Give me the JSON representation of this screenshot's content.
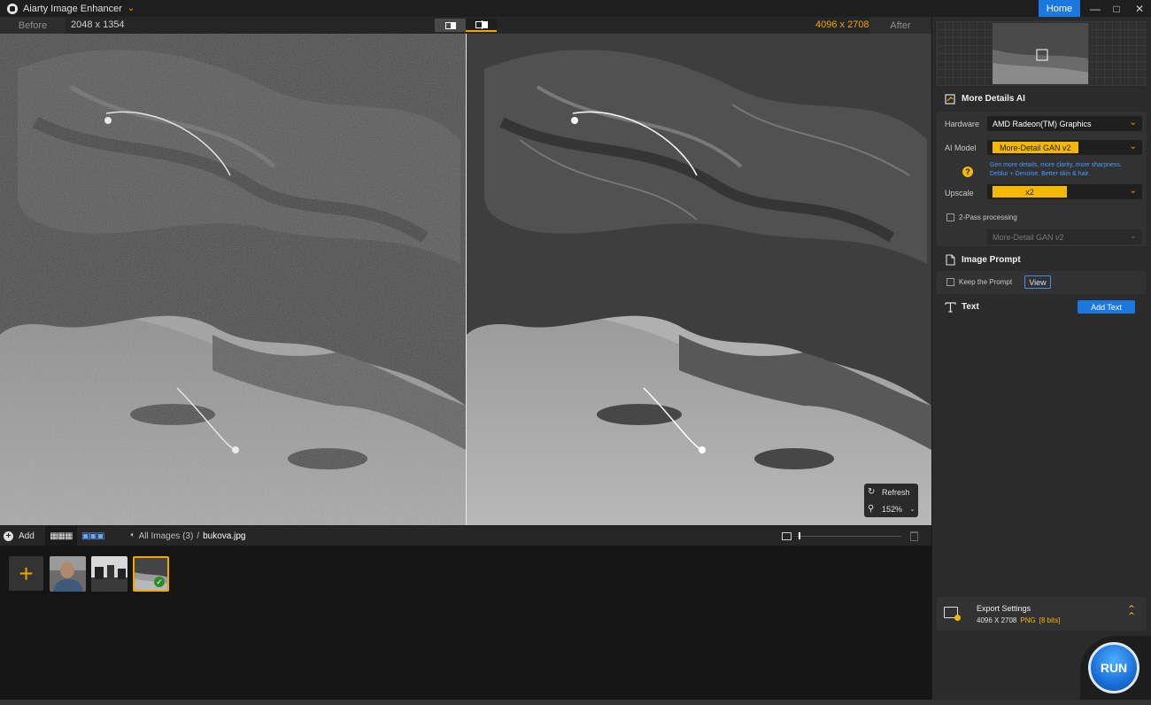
{
  "app": {
    "title": "Aiarty Image Enhancer",
    "home_label": "Home"
  },
  "compare": {
    "before_label": "Before",
    "before_dims": "2048 x 1354",
    "after_label": "After",
    "after_dims": "4096 x 2708"
  },
  "viewer": {
    "refresh_label": "Refresh",
    "zoom_value": "152%"
  },
  "strip": {
    "add_label": "Add",
    "crumb_all": "All Images (3)",
    "crumb_sep": "/",
    "crumb_file": "bukova.jpg",
    "thumb_slider_fraction": 0.02
  },
  "panel": {
    "section_title": "More Details AI",
    "hardware_label": "Hardware",
    "hardware_value": "AMD Radeon(TM) Graphics",
    "ai_model_label": "AI Model",
    "ai_model_value": "More-Detail GAN v2",
    "ai_model_desc_1": "Gen more details, more clarity, more sharpness.",
    "ai_model_desc_2": "Deblur + Denoise. Better skin & hair.",
    "upscale_label": "Upscale",
    "upscale_value": "x2",
    "twopass_label": "2-Pass processing",
    "twopass_model": "More-Detail GAN v2",
    "prompt_title": "Image Prompt",
    "keep_prompt_label": "Keep the Prompt",
    "view_label": "View",
    "text_title": "Text",
    "add_text_label": "Add Text",
    "export_title": "Export Settings",
    "export_dims": "4096 X 2708",
    "export_format": "PNG",
    "export_bits": "[8 bits]",
    "run_label": "RUN"
  },
  "colors": {
    "accent": "#f0a500",
    "primary": "#1a78e0",
    "panel_bg": "#2b2b2b"
  },
  "icons": [
    "app-logo-icon",
    "chevron-down-icon",
    "minimize-icon",
    "maximize-icon",
    "close-icon",
    "refresh-icon",
    "zoom-icon",
    "add-circle-icon",
    "grid-view-icon",
    "filmstrip-view-icon",
    "back-arrow-icon",
    "image-size-icon",
    "trash-icon",
    "details-ai-icon",
    "help-icon",
    "document-icon",
    "text-icon",
    "export-icon",
    "double-chevron-up-icon",
    "checkmark-icon"
  ]
}
